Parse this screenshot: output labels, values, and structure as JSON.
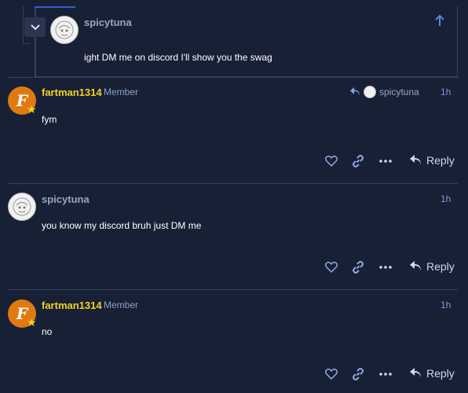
{
  "quote": {
    "username": "spicytuna",
    "text": "ight DM me on discord I'll show you the swag"
  },
  "posts": [
    {
      "username": "fartman1314",
      "badge": "Member",
      "avatar_letter": "F",
      "reply_to": "spicytuna",
      "time": "1h",
      "text": "fym",
      "reply_label": "Reply"
    },
    {
      "username": "spicytuna",
      "time": "1h",
      "text": "you know my discord bruh just DM me",
      "reply_label": "Reply"
    },
    {
      "username": "fartman1314",
      "badge": "Member",
      "avatar_letter": "F",
      "time": "1h",
      "text": "no",
      "reply_label": "Reply"
    }
  ],
  "colors": {
    "background": "#172035",
    "accent": "#7b9bd8",
    "username_member": "#f5d21e",
    "avatar_orange": "#e07a10"
  },
  "icons": [
    "chevron-down-icon",
    "arrow-up-icon",
    "reply-arrow-icon",
    "heart-icon",
    "link-icon",
    "ellipsis-icon",
    "star-icon"
  ]
}
